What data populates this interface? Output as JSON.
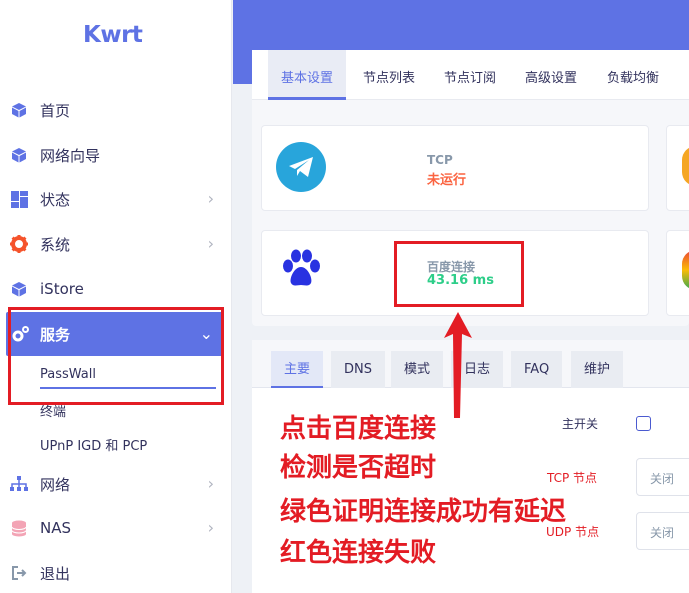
{
  "brand": {
    "logo": "Kwrt"
  },
  "sidebar": {
    "items": [
      {
        "label": "首页",
        "icon": "cube-icon",
        "has_chevron": false
      },
      {
        "label": "网络向导",
        "icon": "cube-icon",
        "has_chevron": false
      },
      {
        "label": "状态",
        "icon": "dashboard-icon",
        "has_chevron": true
      },
      {
        "label": "系统",
        "icon": "gear-icon",
        "has_chevron": true
      },
      {
        "label": "iStore",
        "icon": "cube-icon",
        "has_chevron": false
      },
      {
        "label": "服务",
        "icon": "cogs-icon",
        "has_chevron": true,
        "active": true
      },
      {
        "label": "网络",
        "icon": "sitemap-icon",
        "has_chevron": true
      },
      {
        "label": "NAS",
        "icon": "database-icon",
        "has_chevron": true
      },
      {
        "label": "退出",
        "icon": "logout-icon",
        "has_chevron": false
      }
    ],
    "sub_items": [
      {
        "label": "PassWall",
        "active": true
      },
      {
        "label": "终端",
        "active": false
      },
      {
        "label": "UPnP IGD 和 PCP",
        "active": false
      }
    ]
  },
  "tabs": [
    "基本设置",
    "节点列表",
    "节点订阅",
    "高级设置",
    "负载均衡"
  ],
  "status": {
    "tcp": {
      "title": "TCP",
      "value": "未运行"
    },
    "baidu": {
      "title": "百度连接",
      "value": "43.16 ms"
    }
  },
  "subtabs": [
    "主要",
    "DNS",
    "模式",
    "日志",
    "FAQ",
    "维护"
  ],
  "form": {
    "main_switch": "主开关",
    "tcp_node": "TCP 节点",
    "udp_node": "UDP 节点",
    "tcp_value": "关闭",
    "udp_value": "关闭"
  },
  "annotation": {
    "lines": [
      "点击百度连接",
      "检测是否超时",
      "绿色证明连接成功有延迟",
      "红色连接失败"
    ]
  },
  "colors": {
    "accent": "#5e72e4",
    "annotation_red": "#e31c24",
    "status_fail": "#fb6340",
    "status_ok": "#2dce89"
  }
}
